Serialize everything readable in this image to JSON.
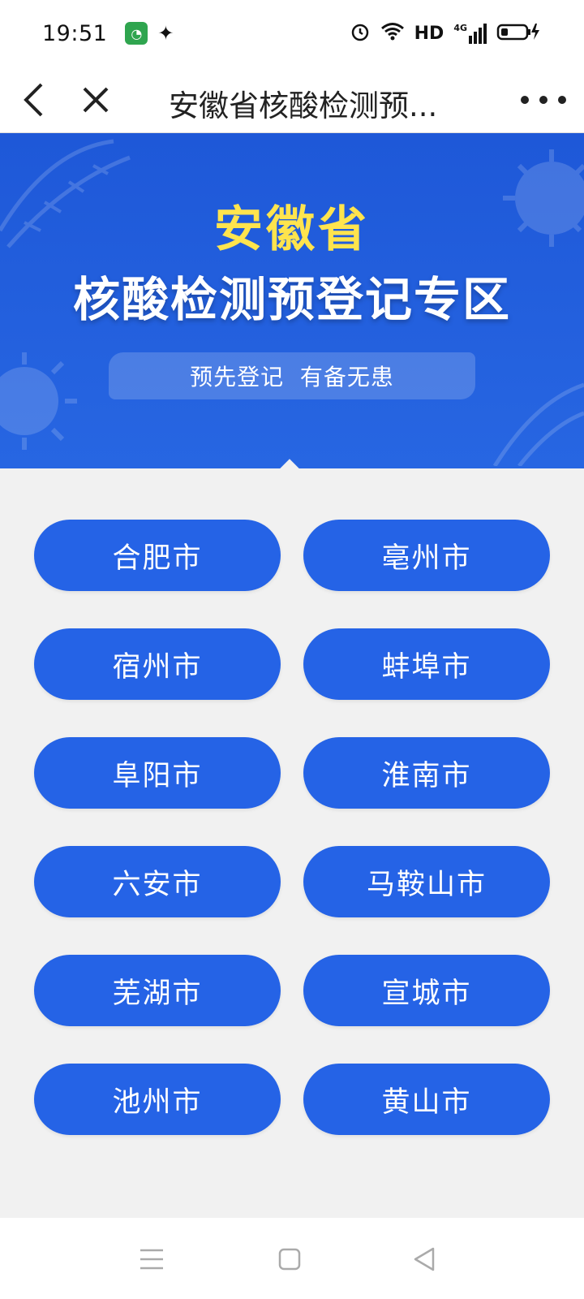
{
  "status": {
    "time": "19:51",
    "network_label": "HD",
    "signal_label": "4G"
  },
  "nav": {
    "title": "安徽省核酸检测预..."
  },
  "banner": {
    "title_province": "安徽省",
    "title_main": "核酸检测预登记专区",
    "slogan": "预先登记  有备无患"
  },
  "cities": [
    {
      "label": "合肥市"
    },
    {
      "label": "亳州市"
    },
    {
      "label": "宿州市"
    },
    {
      "label": "蚌埠市"
    },
    {
      "label": "阜阳市"
    },
    {
      "label": "淮南市"
    },
    {
      "label": "六安市"
    },
    {
      "label": "马鞍山市"
    },
    {
      "label": "芜湖市"
    },
    {
      "label": "宣城市"
    },
    {
      "label": "池州市"
    },
    {
      "label": "黄山市"
    }
  ],
  "colors": {
    "button_blue": "#2563e6",
    "banner_blue": "#1e58d8",
    "title_yellow": "#ffe44d"
  }
}
